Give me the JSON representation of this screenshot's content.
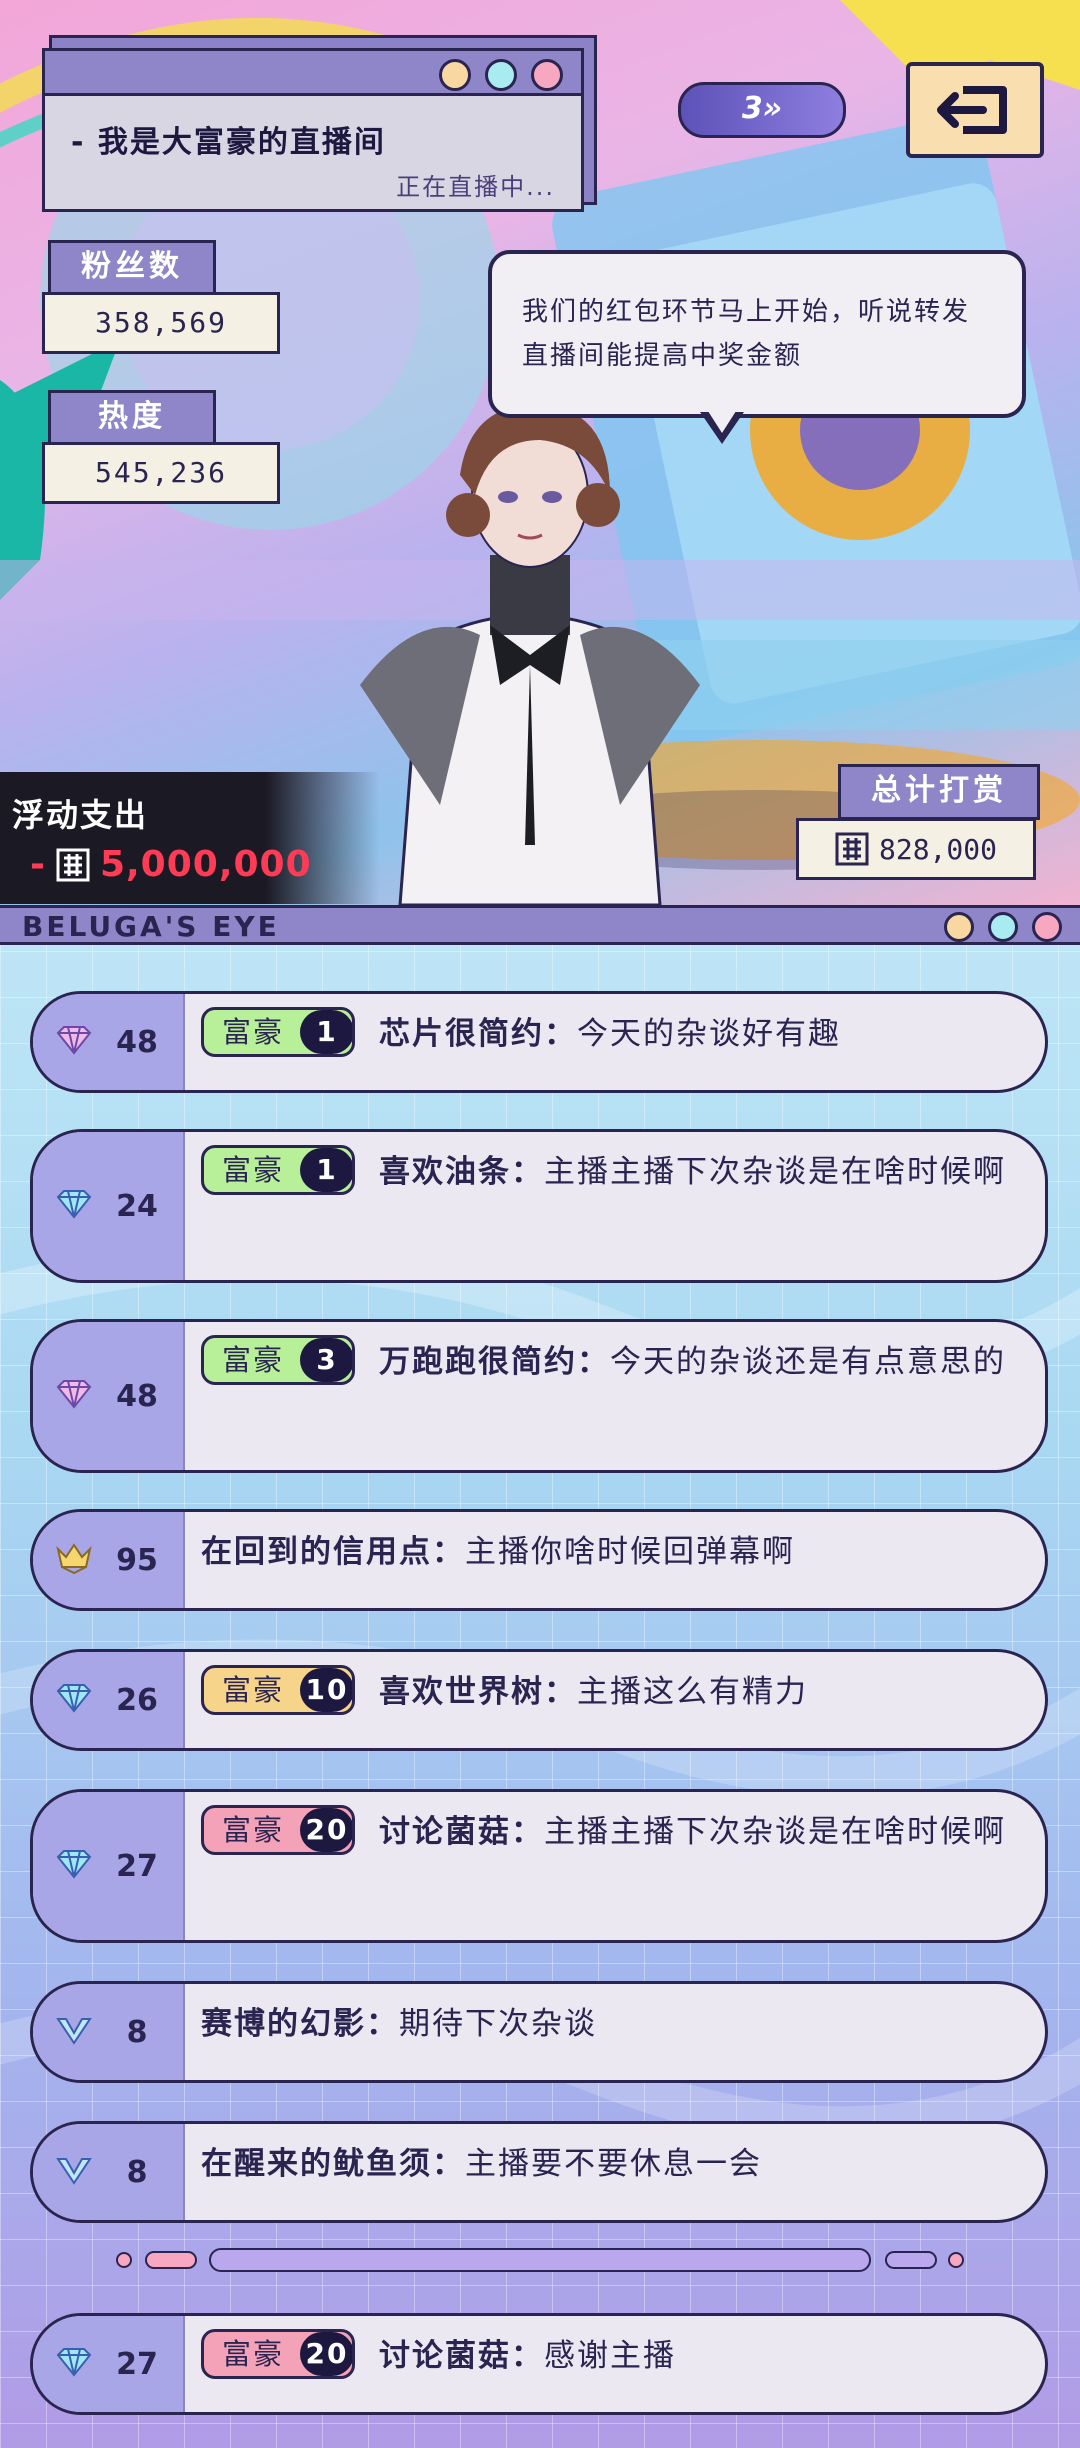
{
  "stream": {
    "title": "- 我是大富豪的直播间",
    "status": "正在直播中...",
    "level": "3»",
    "window_dot_colors": [
      "#f9d7a0",
      "#a8ecf2",
      "#f7a7c0"
    ]
  },
  "stats": {
    "fans_label": "粉丝数",
    "fans_value": "358,569",
    "heat_label": "热度",
    "heat_value": "545,236"
  },
  "speech_bubble": {
    "text": "我们的红包环节马上开始，听说转发直播间能提高中奖金额"
  },
  "floating_expense": {
    "label": "浮动支出",
    "prefix": "-",
    "value": "5,000,000"
  },
  "total_tips": {
    "label": "总计打赏",
    "value": "828,000"
  },
  "chat_panel": {
    "title": "BELUGA'S EYE"
  },
  "badge_colors": {
    "green": "#b8f09a",
    "gold": "#f6d48a",
    "pink": "#f4a2b8"
  },
  "messages": [
    {
      "rank_icon": "pink-diamond-icon",
      "rank_num": "48",
      "badge": "富豪",
      "badge_level": "1",
      "badge_color": "green",
      "username": "芯片很简约：",
      "text": "今天的杂谈好有趣"
    },
    {
      "rank_icon": "blue-diamond-icon",
      "rank_num": "24",
      "badge": "富豪",
      "badge_level": "1",
      "badge_color": "green",
      "username": "喜欢油条：",
      "text": "主播主播下次杂谈是在啥时候啊"
    },
    {
      "rank_icon": "pink-diamond-icon",
      "rank_num": "48",
      "badge": "富豪",
      "badge_level": "3",
      "badge_color": "green",
      "username": "万跑跑很简约：",
      "text": "今天的杂谈还是有点意思的"
    },
    {
      "rank_icon": "crown-icon",
      "rank_num": "95",
      "badge": "",
      "badge_level": "",
      "badge_color": "",
      "username": "在回到的信用点：",
      "text": "主播你啥时候回弹幕啊"
    },
    {
      "rank_icon": "blue-diamond-icon",
      "rank_num": "26",
      "badge": "富豪",
      "badge_level": "10",
      "badge_color": "gold",
      "username": "喜欢世界树：",
      "text": "主播这么有精力"
    },
    {
      "rank_icon": "blue-diamond-icon",
      "rank_num": "27",
      "badge": "富豪",
      "badge_level": "20",
      "badge_color": "pink",
      "username": "讨论菌菇：",
      "text": "主播主播下次杂谈是在啥时候啊"
    },
    {
      "rank_icon": "chevron-icon",
      "rank_num": "8",
      "badge": "",
      "badge_level": "",
      "badge_color": "",
      "username": "赛博的幻影：",
      "text": "期待下次杂谈"
    },
    {
      "rank_icon": "chevron-icon",
      "rank_num": "8",
      "badge": "",
      "badge_level": "",
      "badge_color": "",
      "username": "在醒来的鱿鱼须：",
      "text": "主播要不要休息一会"
    },
    {
      "rank_icon": "blue-diamond-icon",
      "rank_num": "27",
      "badge": "富豪",
      "badge_level": "20",
      "badge_color": "pink",
      "username": "讨论菌菇：",
      "text": "感谢主播"
    }
  ]
}
